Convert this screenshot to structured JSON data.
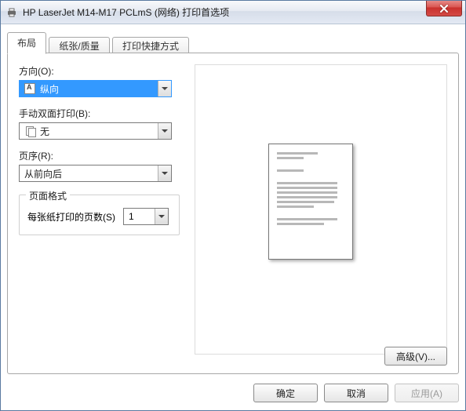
{
  "titlebar": {
    "title": "HP LaserJet M14-M17 PCLmS (网络) 打印首选项"
  },
  "tabs": {
    "layout": "布局",
    "paper": "纸张/质量",
    "shortcut": "打印快捷方式"
  },
  "labels": {
    "orientation": "方向(O):",
    "manual_duplex": "手动双面打印(B):",
    "page_order": "页序(R):",
    "page_format_legend": "页面格式",
    "pages_per_sheet": "每张纸打印的页数(S)"
  },
  "values": {
    "orientation": "纵向",
    "manual_duplex": "无",
    "page_order": "从前向后",
    "pages_per_sheet": "1"
  },
  "buttons": {
    "advanced": "高级(V)...",
    "ok": "确定",
    "cancel": "取消",
    "apply": "应用(A)"
  }
}
